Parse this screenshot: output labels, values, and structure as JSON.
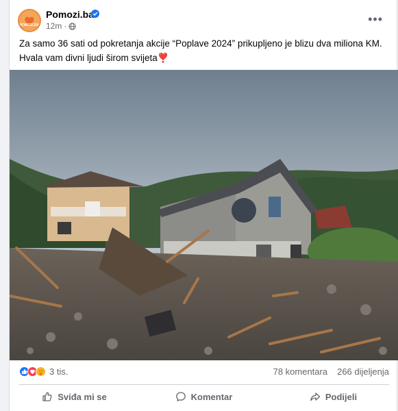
{
  "post": {
    "page_name": "Pomozi.ba",
    "avatar_label": "POMOZI.BA",
    "time": "12m",
    "audience_icon": "globe-icon",
    "text_line1": "Za samo 36 sati od pokretanja akcije “Poplave 2024” prikupljeno je blizu dva miliona KM.",
    "text_line2": "Hvala vam divni ljudi širom svijeta❣️"
  },
  "stats": {
    "reactions_count": "3 tis.",
    "reaction_icons": [
      "like-icon",
      "love-icon",
      "care-icon"
    ],
    "comments": "78 komentara",
    "shares": "266 dijeljenja"
  },
  "actions": {
    "like": "Sviđa mi se",
    "comment": "Komentar",
    "share": "Podijeli"
  },
  "colors": {
    "like_blue": "#1877f2",
    "love_red": "#f33e58",
    "care_yellow": "#f7b125",
    "secondary_text": "#65676b"
  }
}
